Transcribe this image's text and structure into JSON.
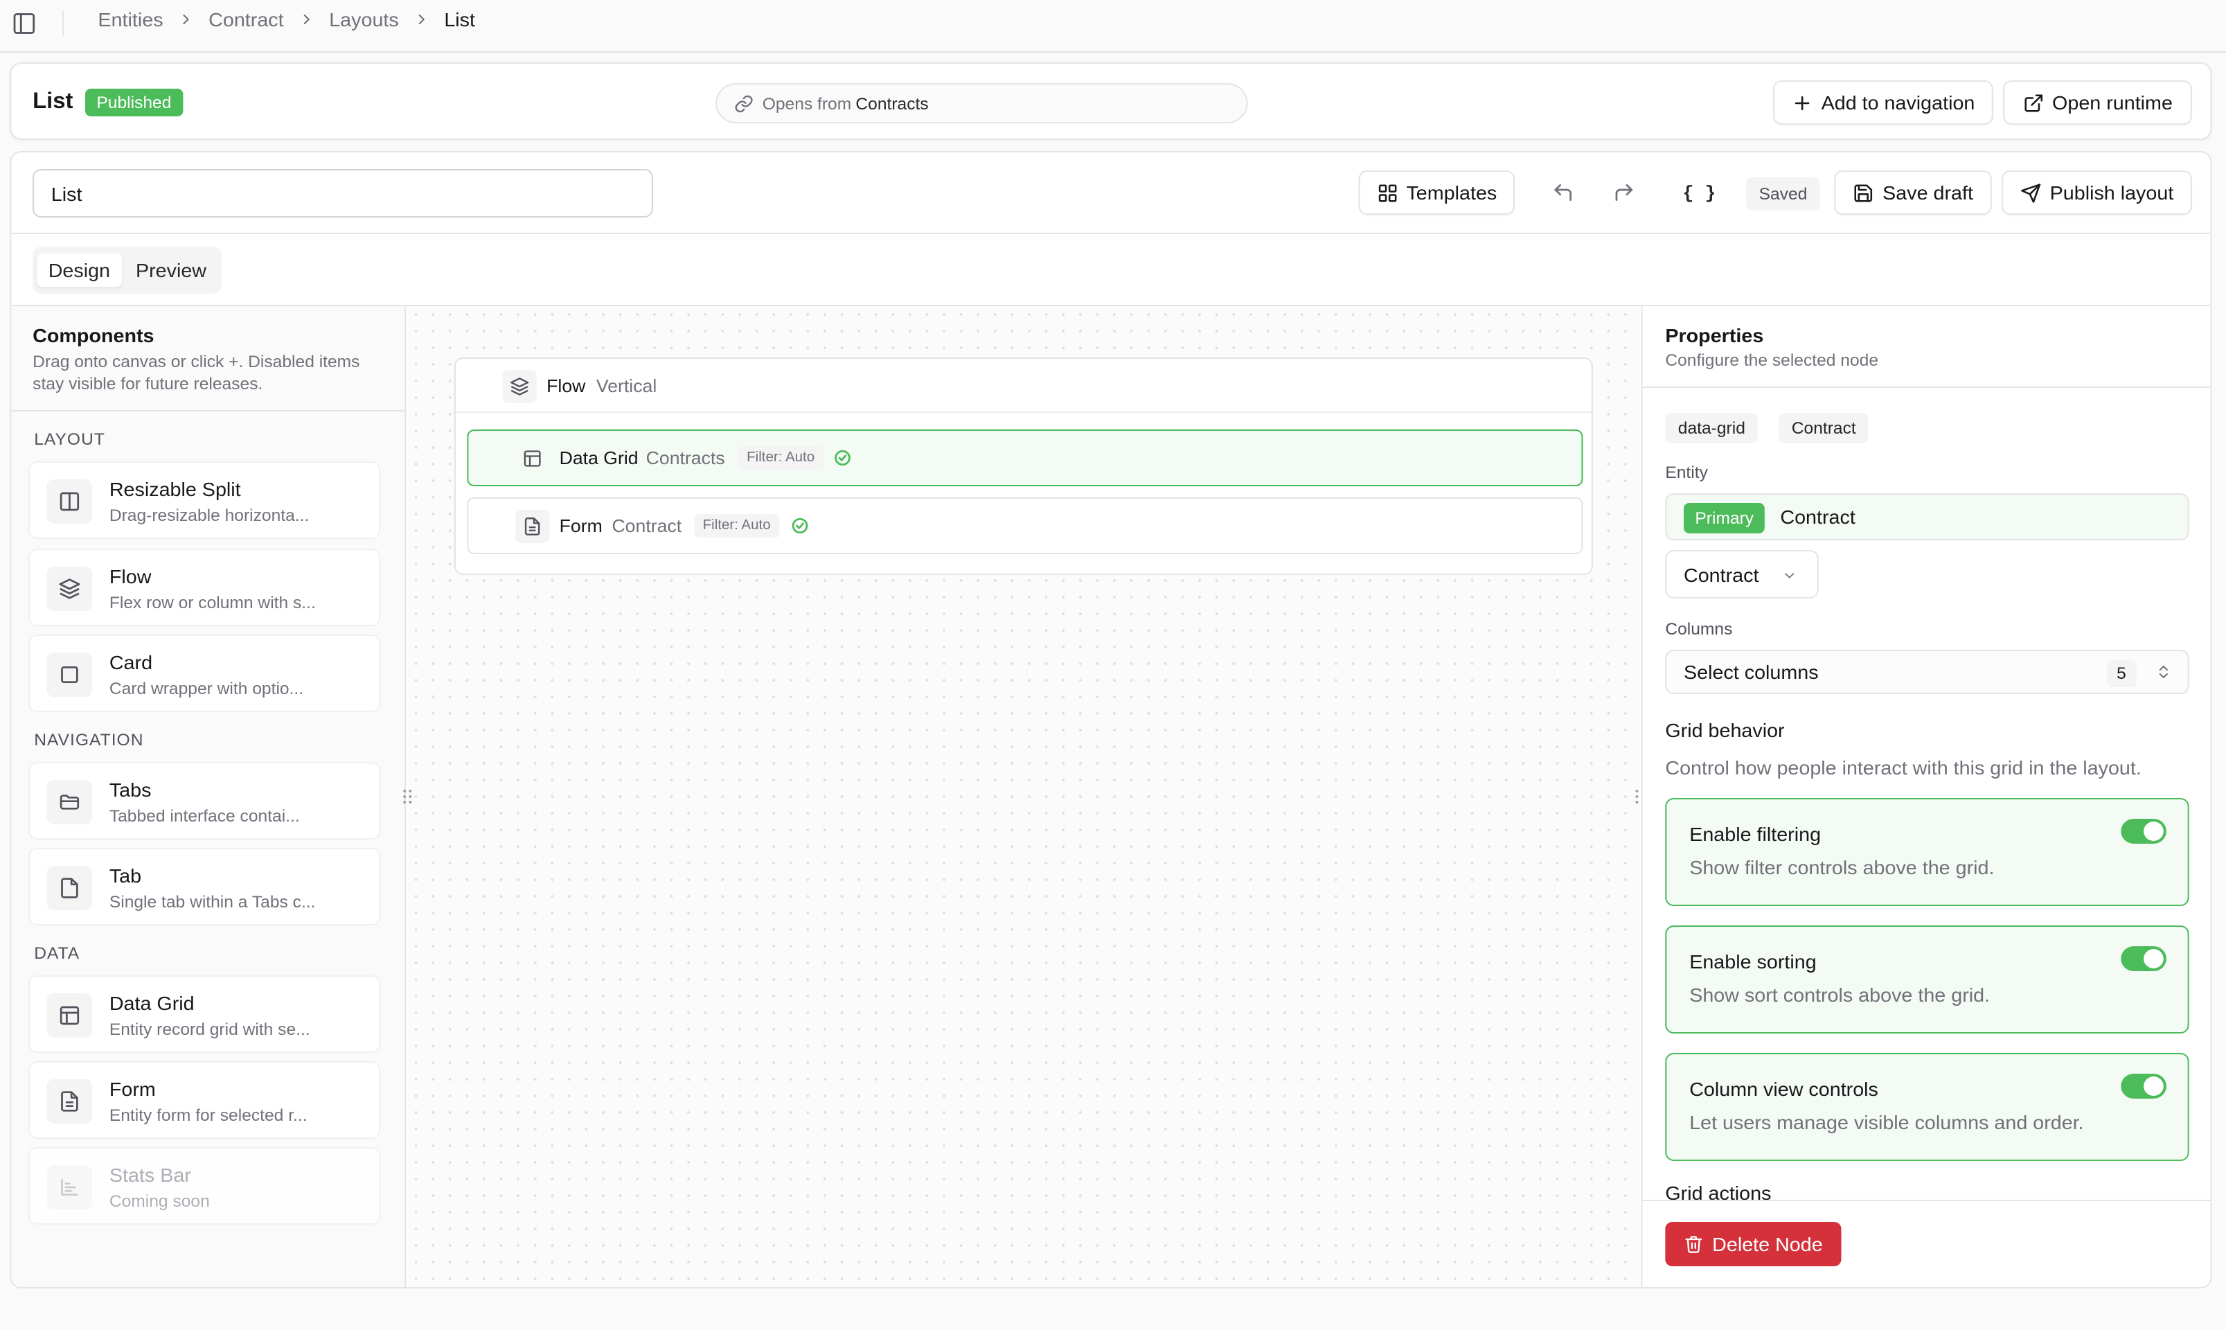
{
  "breadcrumb": [
    "Entities",
    "Contract",
    "Layouts",
    "List"
  ],
  "header": {
    "title": "List",
    "status": "Published",
    "opens_prefix": "Opens from",
    "opens_entity": "Contracts",
    "add_nav": "Add to navigation",
    "open_runtime": "Open runtime"
  },
  "toolbar": {
    "layout_name": "List",
    "templates": "Templates",
    "json_label": "{ }",
    "saved": "Saved",
    "save_draft": "Save draft",
    "publish": "Publish layout"
  },
  "view_tabs": [
    "Design",
    "Preview"
  ],
  "components": {
    "title": "Components",
    "subtitle": "Drag onto canvas or click +. Disabled items stay visible for future releases.",
    "sections": [
      {
        "name": "LAYOUT",
        "items": [
          {
            "name": "Resizable Split",
            "desc": "Drag-resizable horizonta...",
            "icon": "columns-icon"
          },
          {
            "name": "Flow",
            "desc": "Flex row or column with s...",
            "icon": "layers-icon"
          },
          {
            "name": "Card",
            "desc": "Card wrapper with optio...",
            "icon": "square-icon"
          }
        ]
      },
      {
        "name": "NAVIGATION",
        "items": [
          {
            "name": "Tabs",
            "desc": "Tabbed interface contai...",
            "icon": "folder-icon"
          },
          {
            "name": "Tab",
            "desc": "Single tab within a Tabs c...",
            "icon": "file-icon"
          }
        ]
      },
      {
        "name": "DATA",
        "items": [
          {
            "name": "Data Grid",
            "desc": "Entity record grid with se...",
            "icon": "table-icon"
          },
          {
            "name": "Form",
            "desc": "Entity form for selected r...",
            "icon": "file-text-icon"
          },
          {
            "name": "Stats Bar",
            "desc": "Coming soon",
            "icon": "chart-icon",
            "disabled": true
          }
        ]
      }
    ]
  },
  "canvas": {
    "flow": {
      "name": "Flow",
      "direction": "Vertical"
    },
    "nodes": [
      {
        "name": "Data Grid",
        "entity": "Contracts",
        "filter": "Filter: Auto",
        "selected": true
      },
      {
        "name": "Form",
        "entity": "Contract",
        "filter": "Filter: Auto",
        "selected": false
      }
    ]
  },
  "properties": {
    "title": "Properties",
    "subtitle": "Configure the selected node",
    "chips": [
      "data-grid",
      "Contract"
    ],
    "entity_label": "Entity",
    "primary_badge": "Primary",
    "entity_name": "Contract",
    "entity_select": "Contract",
    "columns_label": "Columns",
    "columns_placeholder": "Select columns",
    "columns_count": "5",
    "grid_behavior_title": "Grid behavior",
    "grid_behavior_desc": "Control how people interact with this grid in the layout.",
    "options": [
      {
        "title": "Enable filtering",
        "desc": "Show filter controls above the grid.",
        "enabled": true
      },
      {
        "title": "Enable sorting",
        "desc": "Show sort controls above the grid.",
        "enabled": true
      },
      {
        "title": "Column view controls",
        "desc": "Let users manage visible columns and order.",
        "enabled": true
      }
    ],
    "grid_actions_title": "Grid actions",
    "delete_button": "Delete Node"
  },
  "colors": {
    "accent": "#4cbb5a",
    "danger": "#d4313b"
  }
}
